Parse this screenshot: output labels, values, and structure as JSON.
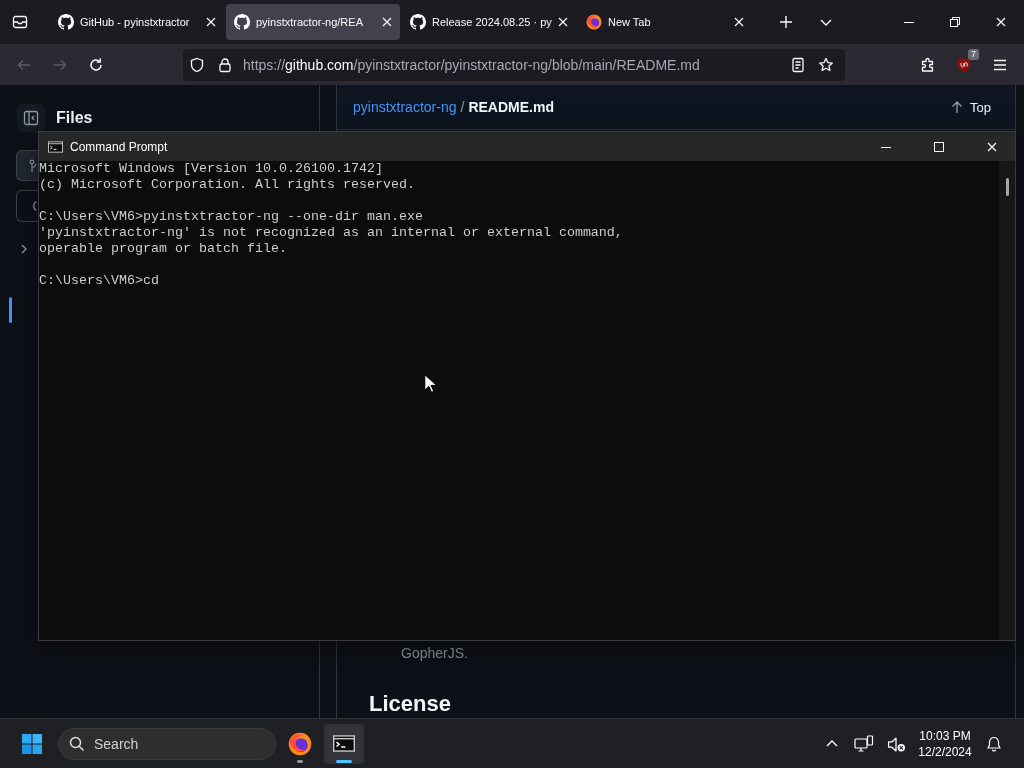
{
  "browser": {
    "tabs": [
      {
        "kind": "github",
        "title": "GitHub - pyinstxtractor",
        "selected": false
      },
      {
        "kind": "github",
        "title": "pyinstxtractor-ng/REA",
        "selected": true
      },
      {
        "kind": "github",
        "title": "Release 2024.08.25 · py",
        "selected": false
      },
      {
        "kind": "firefox",
        "title": "New Tab",
        "selected": false
      }
    ],
    "nav": {
      "back": {
        "disabled": true
      },
      "forward": {
        "disabled": true
      }
    },
    "address": {
      "scheme": "https://",
      "domain": "github.com",
      "path": "/pyinstxtractor/pyinstxtractor-ng/blob/main/README.md"
    },
    "extension_badge": "7"
  },
  "github": {
    "sidebar": {
      "title": "Files"
    },
    "breadcrumb": {
      "repo": "pyinstxtractor-ng",
      "separator": "/",
      "file": "README.md"
    },
    "top_link": "Top",
    "content": [
      {
        "kind": "paragraph",
        "text": "GopherJS."
      },
      {
        "kind": "heading",
        "text": "License"
      }
    ]
  },
  "terminal": {
    "title": "Command Prompt",
    "blocks": [
      [
        "Microsoft Windows [Version 10.0.26100.1742]",
        "(c) Microsoft Corporation. All rights reserved."
      ],
      [
        "C:\\Users\\VM6>pyinstxtractor-ng --one-dir man.exe",
        "'pyinstxtractor-ng' is not recognized as an internal or external command,",
        "operable program or batch file."
      ],
      [
        "C:\\Users\\VM6>cd"
      ]
    ]
  },
  "taskbar": {
    "search_placeholder": "Search",
    "apps": [
      {
        "kind": "firefox",
        "active": false
      },
      {
        "kind": "terminal",
        "active": true
      }
    ],
    "time": "10:03 PM",
    "date": "12/2/2024"
  }
}
